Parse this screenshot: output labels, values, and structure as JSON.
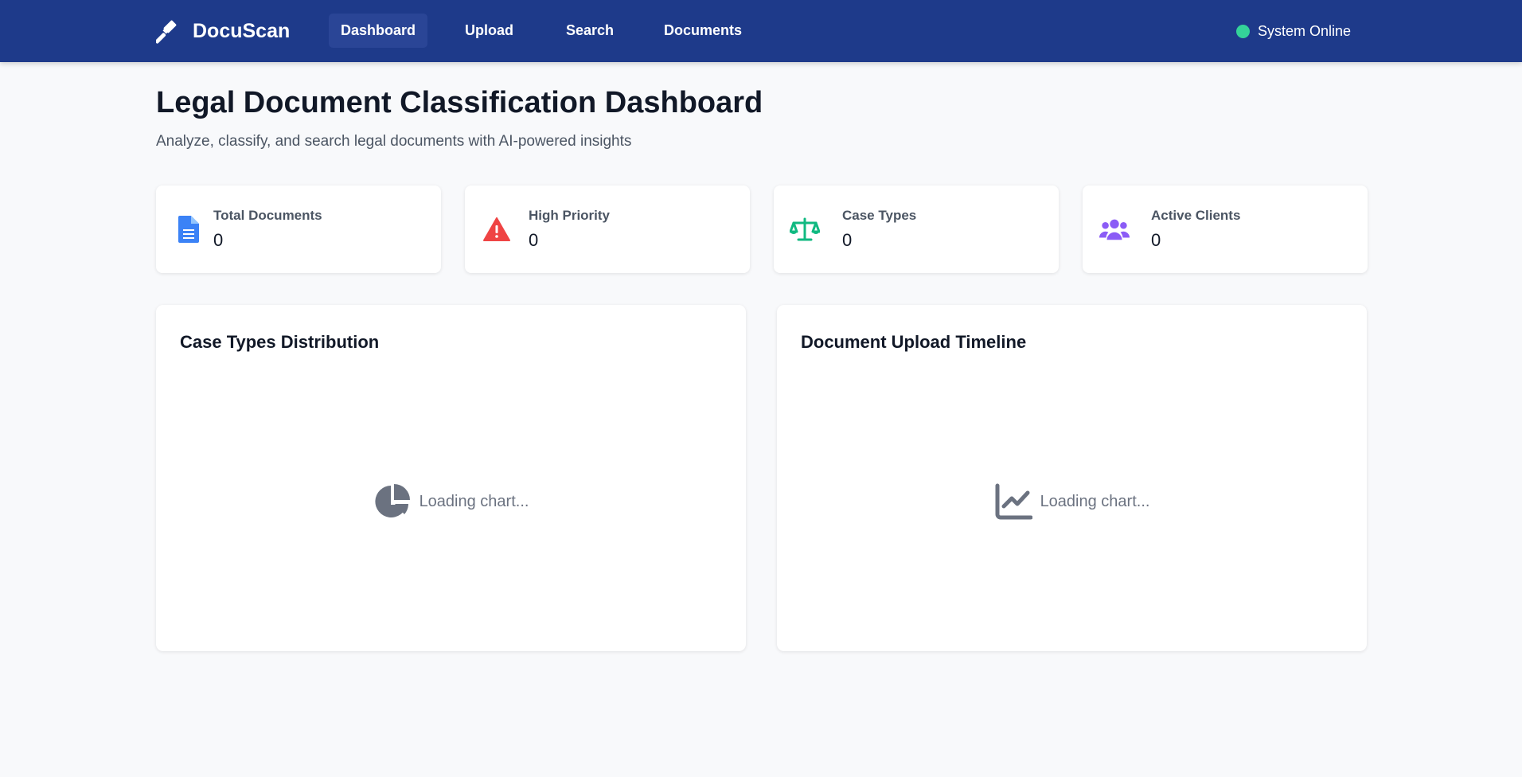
{
  "app": {
    "brand_name": "DocuScan",
    "brand_icon": "gavel-icon"
  },
  "nav": {
    "items": [
      {
        "label": "Dashboard",
        "active": true
      },
      {
        "label": "Upload",
        "active": false
      },
      {
        "label": "Search",
        "active": false
      },
      {
        "label": "Documents",
        "active": false
      }
    ],
    "status_text": "System Online",
    "status_color": "#34d399"
  },
  "header": {
    "title": "Legal Document Classification Dashboard",
    "subtitle": "Analyze, classify, and search legal documents with AI-powered insights"
  },
  "stats": [
    {
      "label": "Total Documents",
      "value": "0",
      "icon": "document-icon",
      "color": "#3b82f6"
    },
    {
      "label": "High Priority",
      "value": "0",
      "icon": "warning-triangle-icon",
      "color": "#ef4444"
    },
    {
      "label": "Case Types",
      "value": "0",
      "icon": "scale-balance-icon",
      "color": "#10b981"
    },
    {
      "label": "Active Clients",
      "value": "0",
      "icon": "users-icon",
      "color": "#8b5cf6"
    }
  ],
  "charts": [
    {
      "title": "Case Types Distribution",
      "loading_text": "Loading chart...",
      "icon": "pie-chart-icon"
    },
    {
      "title": "Document Upload Timeline",
      "loading_text": "Loading chart...",
      "icon": "line-chart-icon"
    }
  ],
  "colors": {
    "navbar": "#1e3a8a",
    "nav_active": "#2a4596",
    "background": "#f8f9fb",
    "muted_icon": "#6b7280"
  }
}
